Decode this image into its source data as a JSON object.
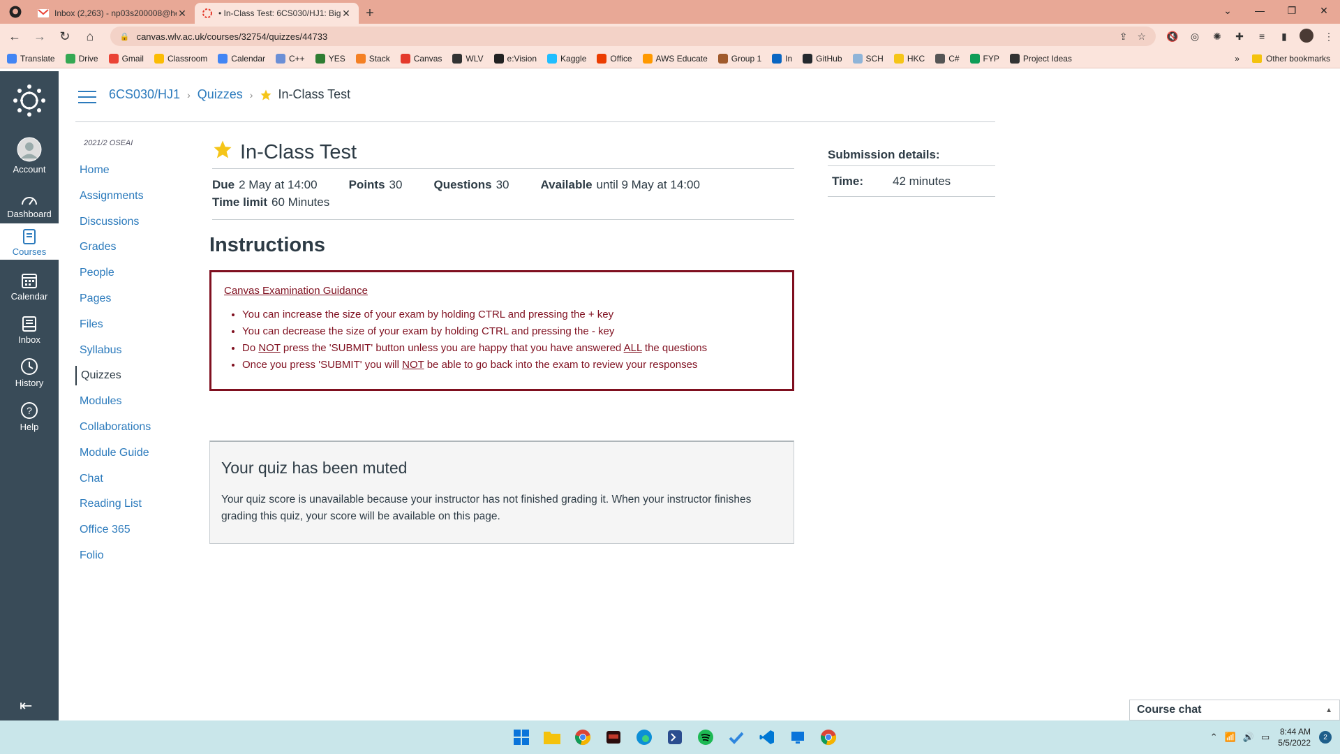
{
  "browser": {
    "tabs": [
      {
        "title": "Inbox (2,263) - np03s200008@he",
        "icon": "gmail-icon"
      },
      {
        "title": "• In-Class Test: 6CS030/HJ1: Big",
        "icon": "canvas-icon"
      }
    ],
    "url": "canvas.wlv.ac.uk/courses/32754/quizzes/44733",
    "bookmarks": [
      {
        "label": "Translate",
        "color": "#4285f4"
      },
      {
        "label": "Drive",
        "color": "#34a853"
      },
      {
        "label": "Gmail",
        "color": "#ea4335"
      },
      {
        "label": "Classroom",
        "color": "#fbbc04"
      },
      {
        "label": "Calendar",
        "color": "#4285f4"
      },
      {
        "label": "C++",
        "color": "#6b8fd6"
      },
      {
        "label": "YES",
        "color": "#2e7d32"
      },
      {
        "label": "Stack",
        "color": "#f48024"
      },
      {
        "label": "Canvas",
        "color": "#e4392b"
      },
      {
        "label": "WLV",
        "color": "#333333"
      },
      {
        "label": "e:Vision",
        "color": "#222222"
      },
      {
        "label": "Kaggle",
        "color": "#20beff"
      },
      {
        "label": "Office",
        "color": "#eb3c00"
      },
      {
        "label": "AWS Educate",
        "color": "#ff9900"
      },
      {
        "label": "Group 1",
        "color": "#a05a2c"
      },
      {
        "label": "In",
        "color": "#0a66c2"
      },
      {
        "label": "GitHub",
        "color": "#24292e"
      },
      {
        "label": "SCH",
        "color": "#8fb4d8"
      },
      {
        "label": "HKC",
        "color": "#f5c518"
      },
      {
        "label": "C#",
        "color": "#555555"
      },
      {
        "label": "FYP",
        "color": "#0f9d58"
      },
      {
        "label": "Project Ideas",
        "color": "#333333"
      }
    ],
    "bookmarks_more": "»",
    "other_bookmarks": "Other bookmarks"
  },
  "global_nav": {
    "items": [
      {
        "label": "Account",
        "icon": "account-icon"
      },
      {
        "label": "Dashboard",
        "icon": "dashboard-icon"
      },
      {
        "label": "Courses",
        "icon": "courses-icon"
      },
      {
        "label": "Calendar",
        "icon": "calendar-icon"
      },
      {
        "label": "Inbox",
        "icon": "inbox-icon"
      },
      {
        "label": "History",
        "icon": "history-icon"
      },
      {
        "label": "Help",
        "icon": "help-icon"
      }
    ]
  },
  "breadcrumb": {
    "course": "6CS030/HJ1",
    "section": "Quizzes",
    "current": "In-Class Test"
  },
  "course_nav": {
    "term": "2021/2 OSEAI",
    "items": [
      "Home",
      "Assignments",
      "Discussions",
      "Grades",
      "People",
      "Pages",
      "Files",
      "Syllabus",
      "Quizzes",
      "Modules",
      "Collaborations",
      "Module Guide",
      "Chat",
      "Reading List",
      "Office 365",
      "Folio"
    ],
    "active": "Quizzes"
  },
  "quiz": {
    "title": "In-Class Test",
    "due_label": "Due",
    "due_value": "2 May at 14:00",
    "points_label": "Points",
    "points_value": "30",
    "questions_label": "Questions",
    "questions_value": "30",
    "available_label": "Available",
    "available_value": "until 9 May at 14:00",
    "time_limit_label": "Time limit",
    "time_limit_value": "60 Minutes"
  },
  "instructions": {
    "heading": "Instructions",
    "guide_link": "Canvas Examination Guidance",
    "b1": "You can increase the size of your exam by holding CTRL and pressing the + key",
    "b2": "You can decrease the size of your exam by holding CTRL and pressing the - key",
    "b3_pre": "Do ",
    "b3_not": "NOT",
    "b3_mid": " press the 'SUBMIT' button unless you are happy that you have answered ",
    "b3_all": "ALL",
    "b3_post": " the questions",
    "b4_pre": "Once you press 'SUBMIT' you will ",
    "b4_not": "NOT",
    "b4_post": " be able to go back into the exam to review your responses",
    "border_color": "#7f0f1f"
  },
  "muted": {
    "heading": "Your quiz has been muted",
    "text": "Your quiz score is unavailable because your instructor has not finished grading it. When your instructor finishes grading this quiz, your score will be available on this page."
  },
  "submission": {
    "label": "Submission details:",
    "time_label": "Time:",
    "time_value": "42 minutes"
  },
  "chat_widget": {
    "label": "Course chat"
  },
  "taskbar": {
    "time": "8:44 AM",
    "date": "5/5/2022",
    "notifications": "2"
  },
  "colors": {
    "link": "#2b7abc",
    "global_nav_bg": "#394b58",
    "chrome_tab_bg": "#e8a896",
    "chrome_toolbar_bg": "#fbe4dc"
  }
}
